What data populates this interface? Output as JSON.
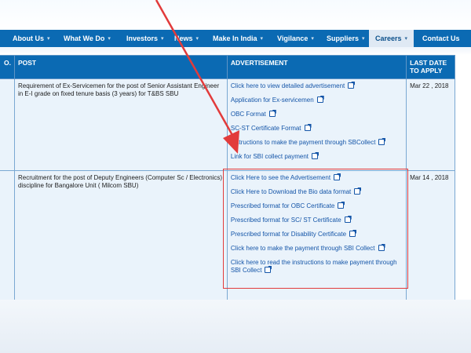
{
  "nav": {
    "items": [
      {
        "label": "About Us",
        "caret": true
      },
      {
        "label": "What We Do",
        "caret": true
      },
      {
        "label": "Investors",
        "caret": true
      },
      {
        "label": "News",
        "caret": true
      },
      {
        "label": "Make In India",
        "caret": true
      },
      {
        "label": "Vigilance",
        "caret": true
      },
      {
        "label": "Suppliers",
        "caret": true
      },
      {
        "label": "Careers",
        "caret": true,
        "active": true
      },
      {
        "label": "Contact Us",
        "caret": false
      }
    ],
    "caret_glyph": "▾"
  },
  "table": {
    "headers": {
      "no": "O.",
      "post": "POST",
      "advertisement": "ADVERTISEMENT",
      "last_date": "LAST DATE TO APPLY"
    },
    "rows": [
      {
        "post": "Requirement of Ex-Servicemen for the post of Senior Assistant Engineer in E-I grade on fixed tenure basis (3 years) for T&BS SBU",
        "links": [
          "Click here to view detailed advertisement",
          "Application for Ex-servicemen",
          "OBC Format",
          "SC-ST Certificate Format",
          "Instructions to make the payment through SBCollect",
          "Link for SBI collect payment"
        ],
        "last_date": "Mar 22 , 2018"
      },
      {
        "post": "Recruitment for the post of Deputy Engineers (Computer Sc / Electronics) discipline for Bangalore Unit ( Milcom SBU)",
        "links": [
          "Click Here to see the Advertisement",
          "Click Here to Download the Bio data format",
          "Prescribed format for OBC Certificate",
          "Prescribed format for SC/ ST Certificate",
          "Prescribed format for Disability Certificate",
          "Click here to make the payment through SBI Collect",
          "Click here to read the instructions to make payment through SBI Collect"
        ],
        "last_date": "Mar 14 , 2018"
      }
    ]
  },
  "annotation": {
    "arrow_color": "#e23b3b",
    "box_color": "#e23b3b"
  },
  "colors": {
    "nav_bg": "#0b6ab3",
    "link": "#1455a8",
    "cell_bg": "#eaf3fb"
  }
}
